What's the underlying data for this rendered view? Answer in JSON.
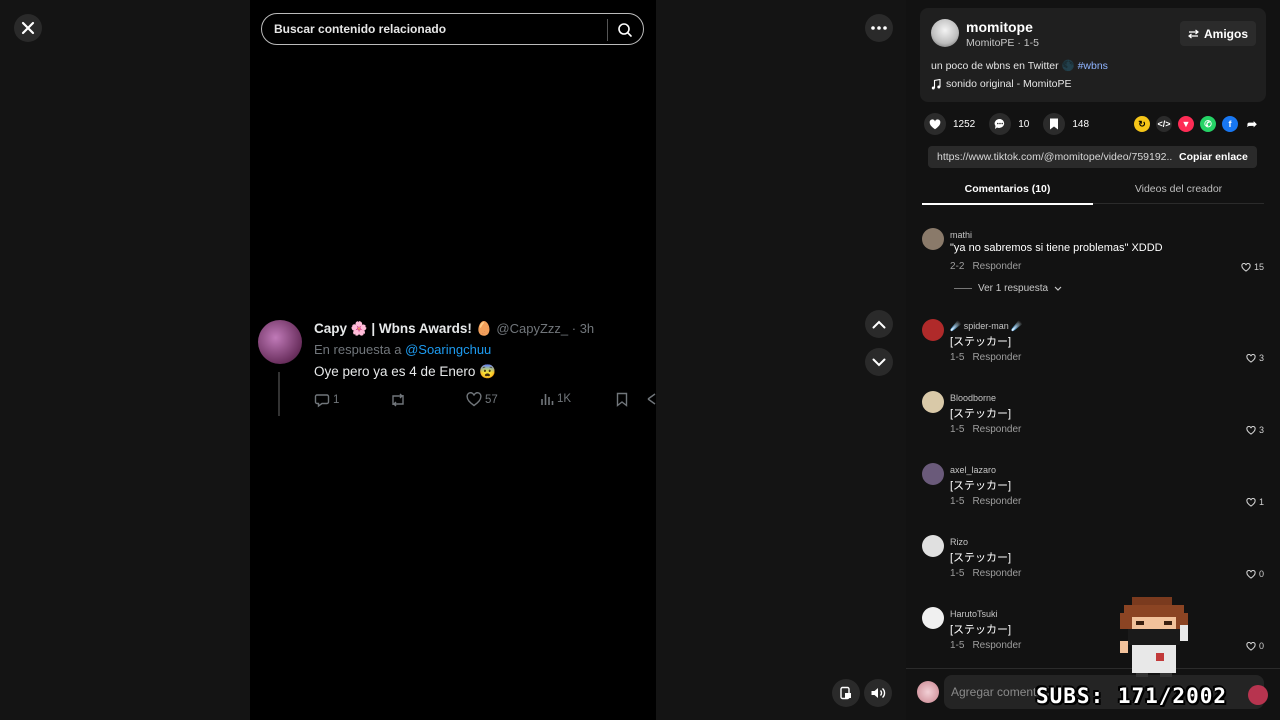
{
  "player": {
    "search_placeholder": "Buscar contenido relacionado",
    "tweet": {
      "name": "Capy 🌸 | Wbns Awards! 🥚",
      "handle": "@CapyZzz_ · 3h",
      "reply_prefix": "En respuesta a",
      "reply_to": "@Soaringchuu",
      "text": "Oye pero ya es 4 de Enero 😨",
      "replies": "1",
      "likes": "57",
      "views": "1K"
    }
  },
  "creator": {
    "username": "momitope",
    "subline": "MomitoPE · 1-5",
    "friends_label": "Amigos",
    "description": "un poco de wbns en Twitter 🌑",
    "hashtag": "#wbns",
    "music": "sonido original - MomitoPE"
  },
  "stats": {
    "likes": "1252",
    "comments": "10",
    "saves": "148"
  },
  "share_link": {
    "url": "https://www.tiktok.com/@momitope/video/759192...",
    "copy_label": "Copiar enlace"
  },
  "tabs": {
    "comments": "Comentarios (10)",
    "creator_videos": "Videos del creador"
  },
  "comments": [
    {
      "user": "mathi",
      "text": "\"ya no sabremos si tiene problemas\" XDDD",
      "date": "2-2",
      "reply": "Responder",
      "likes": "15",
      "color": "#8a7a6a"
    },
    {
      "user": "☄️ spider-man ☄️",
      "text": "[ステッカー]",
      "date": "1-5",
      "reply": "Responder",
      "likes": "3",
      "color": "#b02a2a"
    },
    {
      "user": "Bloodborne",
      "text": "[ステッカー]",
      "date": "1-5",
      "reply": "Responder",
      "likes": "3",
      "color": "#d9c9a8"
    },
    {
      "user": "axel_lazaro",
      "text": "[ステッカー]",
      "date": "1-5",
      "reply": "Responder",
      "likes": "1",
      "color": "#6a5a7a"
    },
    {
      "user": "Rizo",
      "text": "[ステッカー]",
      "date": "1-5",
      "reply": "Responder",
      "likes": "0",
      "color": "#e0e0e0"
    },
    {
      "user": "HarutoTsuki",
      "text": "[ステッカー]",
      "date": "1-5",
      "reply": "Responder",
      "likes": "0",
      "color": "#f0f0f0"
    }
  ],
  "view_replies": "Ver 1 respuesta",
  "comment_input_placeholder": "Agregar comentario...",
  "overlay": {
    "subs": "SUBS: 171/2002"
  }
}
